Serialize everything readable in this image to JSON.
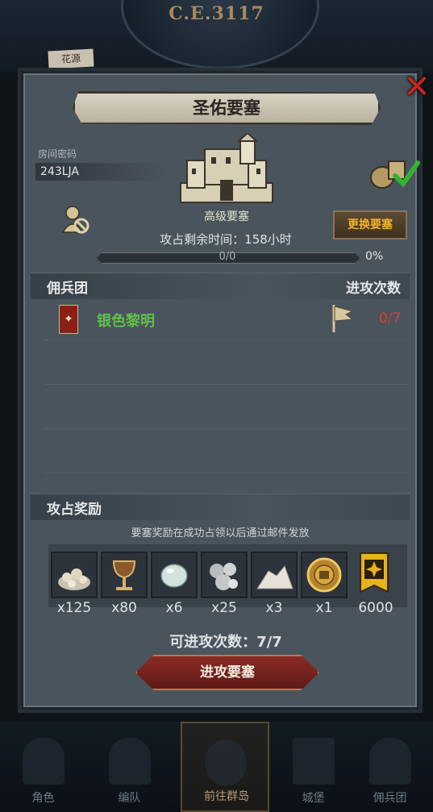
{
  "background": {
    "year": "C.E.3117",
    "chip_label": "花源"
  },
  "bottom_nav": {
    "items": [
      {
        "label": "角色"
      },
      {
        "label": "编队"
      },
      {
        "label": "前往群岛"
      },
      {
        "label": "城堡"
      },
      {
        "label": "佣兵团"
      }
    ],
    "active_index": 2
  },
  "dialog": {
    "title": "圣佑要塞",
    "room": {
      "label": "房间密码",
      "code": "243LJA"
    },
    "fortress_level": "高级要塞",
    "change_button": "更换要塞",
    "time_remaining": "攻占剩余时间：158小时",
    "progress": {
      "text": "0/0",
      "percent": "0%",
      "fraction": 0
    },
    "guild_section": {
      "title": "佣兵团",
      "attacks_header": "进攻次数",
      "guild_name": "银色黎明",
      "attack_count": "0/7"
    },
    "reward_section": {
      "title": "攻占奖励",
      "note": "要塞奖励在成功占领以后通过邮件发放",
      "items": [
        {
          "icon": "ore-pile-icon",
          "qty": "x125"
        },
        {
          "icon": "goblet-icon",
          "qty": "x80"
        },
        {
          "icon": "moonstone-icon",
          "qty": "x6"
        },
        {
          "icon": "silver-nuggets-icon",
          "qty": "x25"
        },
        {
          "icon": "salt-pile-icon",
          "qty": "x3"
        },
        {
          "icon": "gold-medal-icon",
          "qty": "x1"
        },
        {
          "icon": "guild-banner-icon",
          "qty": "6000"
        }
      ]
    },
    "attacks_left": "可进攻次数：7/7",
    "attack_button": "进攻要塞"
  },
  "colors": {
    "panel": "#4a545d",
    "accent_gold": "#f1b32c",
    "guild_green": "#5fc04a",
    "count_red": "#d0443a",
    "button_red": "#8c2b25"
  }
}
